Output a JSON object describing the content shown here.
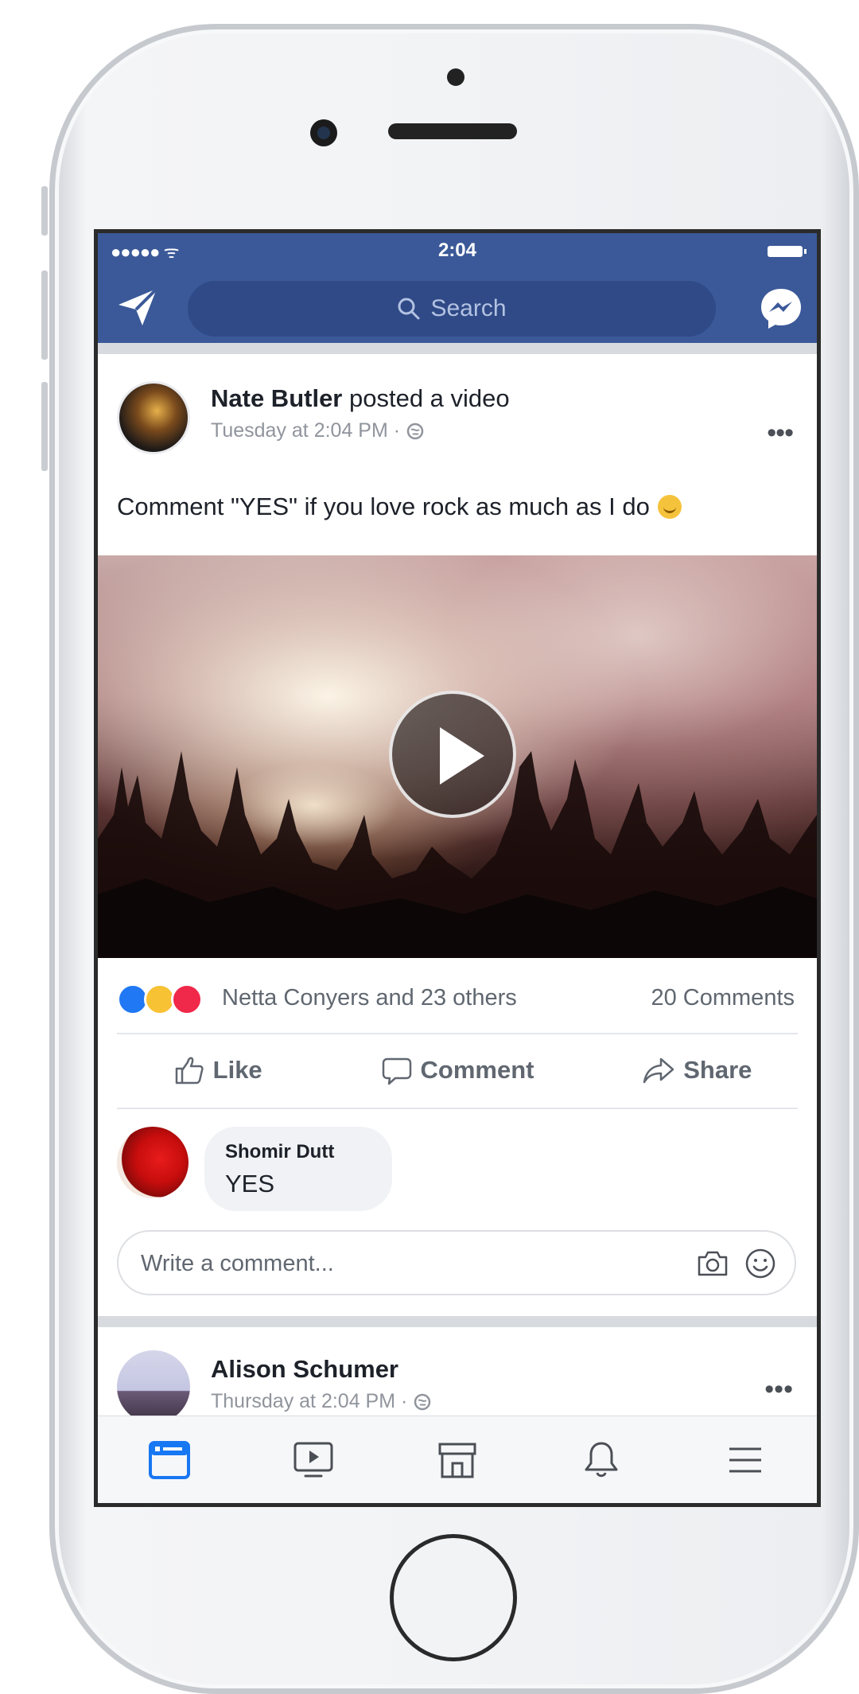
{
  "status_bar": {
    "signal": "●●●●● ᯤ",
    "time": "2:04"
  },
  "nav": {
    "search_placeholder": "Search"
  },
  "post": {
    "author": "Nate Butler",
    "action": " posted a video",
    "time": "Tuesday at 2:04 PM · ",
    "text": "Comment \"YES\" if you love rock as much as I do",
    "more": "•••"
  },
  "reactions": {
    "names": "Netta Conyers and 23 others",
    "comments": "20 Comments"
  },
  "actions": {
    "like": "Like",
    "comment": "Comment",
    "share": "Share"
  },
  "comment": {
    "author": "Shomir Dutt",
    "text": "YES"
  },
  "write_comment": {
    "placeholder": "Write a comment..."
  },
  "next_post": {
    "author": "Alison Schumer",
    "time": "Thursday at 2:04 PM · ",
    "more": "•••"
  },
  "tabs": [
    {
      "icon": "news-feed-icon",
      "active": true
    },
    {
      "icon": "watch-icon",
      "active": false
    },
    {
      "icon": "marketplace-icon",
      "active": false
    },
    {
      "icon": "notifications-icon",
      "active": false
    },
    {
      "icon": "menu-icon",
      "active": false
    }
  ],
  "colors": {
    "brand": "#3b5998",
    "active_tab": "#1877f2",
    "text": "#1d2129",
    "secondary_text": "#606770"
  }
}
